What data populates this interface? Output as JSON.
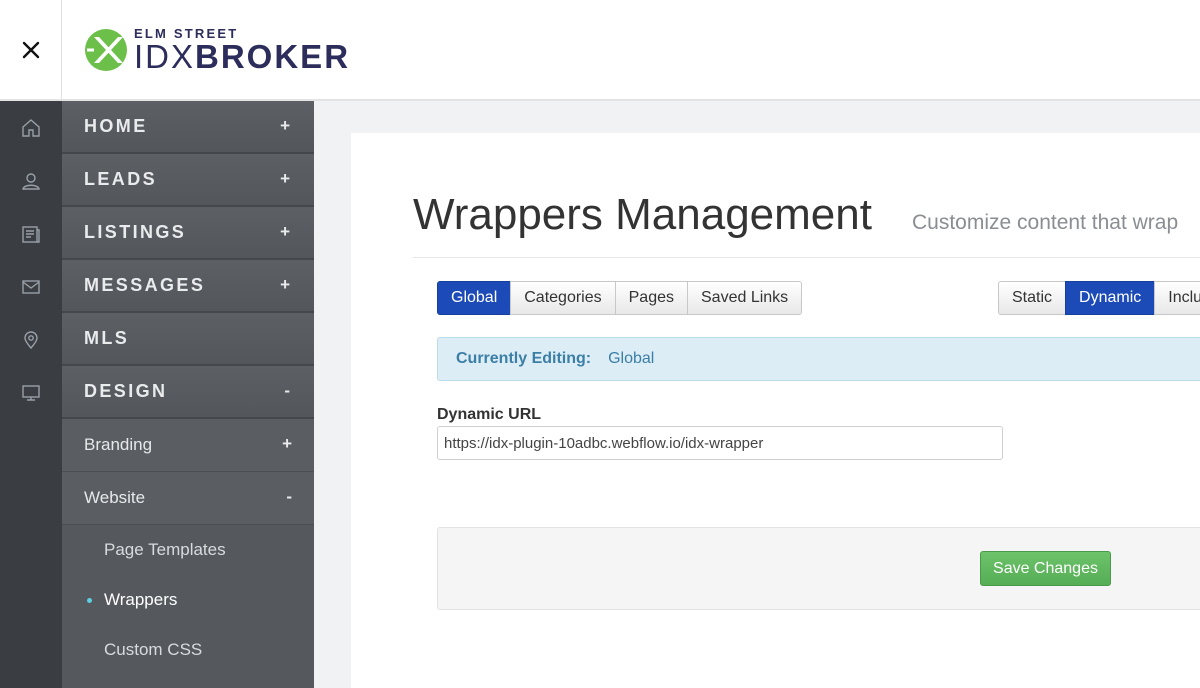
{
  "header": {
    "close_icon": "close-icon",
    "logo": {
      "top_text": "ELM STREET",
      "idx_text": "IDX",
      "broker_text": "BROKER",
      "mark_color": "#6cc04a",
      "text_color": "#2c2d5b"
    }
  },
  "rail": {
    "icons": [
      "home-icon",
      "user-icon",
      "listings-icon",
      "mail-icon",
      "map-pin-icon",
      "monitor-icon"
    ]
  },
  "sidebar": {
    "menu": [
      {
        "label": "HOME",
        "sign": "+"
      },
      {
        "label": "LEADS",
        "sign": "+"
      },
      {
        "label": "LISTINGS",
        "sign": "+"
      },
      {
        "label": "MESSAGES",
        "sign": "+"
      },
      {
        "label": "MLS",
        "sign": ""
      },
      {
        "label": "DESIGN",
        "sign": "-"
      }
    ],
    "design_sub": [
      {
        "label": "Branding",
        "sign": "+"
      },
      {
        "label": "Website",
        "sign": "-"
      }
    ],
    "website_sub": [
      {
        "label": "Page Templates",
        "active": false
      },
      {
        "label": "Wrappers",
        "active": true
      },
      {
        "label": "Custom CSS",
        "active": false
      }
    ]
  },
  "main": {
    "title": "Wrappers Management",
    "subtitle": "Customize content that wrap",
    "scope_tabs": [
      "Global",
      "Categories",
      "Pages",
      "Saved Links"
    ],
    "scope_active": "Global",
    "type_tabs": [
      "Static",
      "Dynamic",
      "Inclu"
    ],
    "type_active": "Dynamic",
    "editing_label": "Currently Editing:",
    "editing_value": "Global",
    "dynamic_url_label": "Dynamic URL",
    "dynamic_url_value": "https://idx-plugin-10adbc.webflow.io/idx-wrapper",
    "save_label": "Save Changes"
  },
  "colors": {
    "accent": "#1c4bb8",
    "success": "#5cb85c",
    "sidebar": "#55595e",
    "rail": "#3a3d42"
  }
}
